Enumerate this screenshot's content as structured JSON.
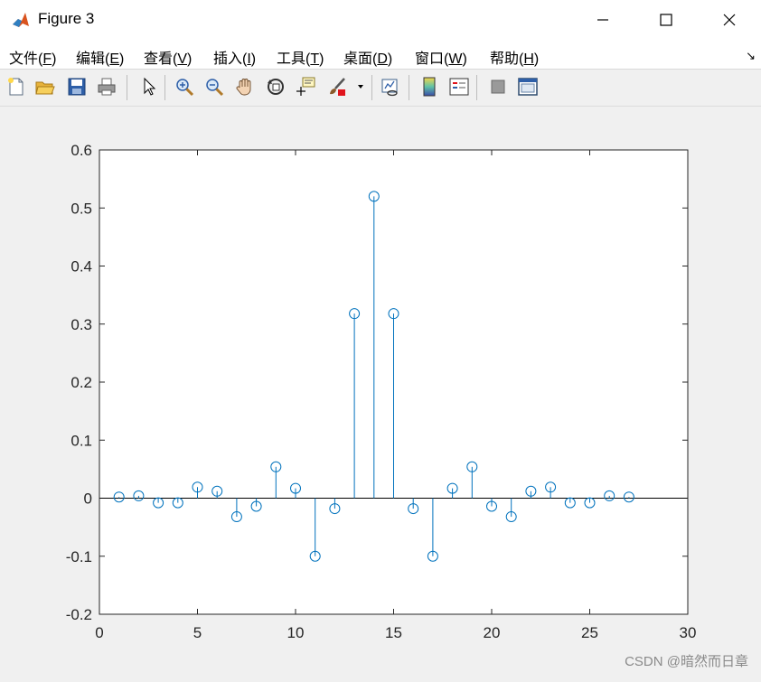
{
  "window": {
    "title": "Figure 3",
    "controls": {
      "minimize": "—",
      "maximize": "☐",
      "close": "✕"
    }
  },
  "menu": {
    "items": [
      {
        "label": "文件(",
        "key": "F",
        "suffix": ")"
      },
      {
        "label": "编辑(",
        "key": "E",
        "suffix": ")"
      },
      {
        "label": "查看(",
        "key": "V",
        "suffix": ")"
      },
      {
        "label": "插入(",
        "key": "I",
        "suffix": ")"
      },
      {
        "label": "工具(",
        "key": "T",
        "suffix": ")"
      },
      {
        "label": "桌面(",
        "key": "D",
        "suffix": ")"
      },
      {
        "label": "窗口(",
        "key": "W",
        "suffix": ")"
      },
      {
        "label": "帮助(",
        "key": "H",
        "suffix": ")"
      }
    ],
    "dock_arrow": "↘"
  },
  "toolbar": {
    "icons": [
      "new-figure-icon",
      "open-file-icon",
      "save-icon",
      "print-icon",
      "pointer-icon",
      "zoom-in-icon",
      "zoom-out-icon",
      "pan-hand-icon",
      "rotate-3d-icon",
      "data-cursor-icon",
      "brush-icon",
      "link-plot-icon",
      "colorbar-icon",
      "legend-icon",
      "hide-plot-tools-icon",
      "show-plot-tools-icon"
    ]
  },
  "chart_data": {
    "type": "stem",
    "title": "",
    "xlabel": "",
    "ylabel": "",
    "xlim": [
      0,
      30
    ],
    "ylim": [
      -0.2,
      0.6
    ],
    "xticks": [
      0,
      5,
      10,
      15,
      20,
      25,
      30
    ],
    "yticks": [
      -0.2,
      -0.1,
      0,
      0.1,
      0.2,
      0.3,
      0.4,
      0.5,
      0.6
    ],
    "ytick_labels": [
      "-0.2",
      "-0.1",
      "0",
      "0.1",
      "0.2",
      "0.3",
      "0.4",
      "0.5",
      "0.6"
    ],
    "xtick_labels": [
      "0",
      "5",
      "10",
      "15",
      "20",
      "25",
      "30"
    ],
    "grid": false,
    "series": [
      {
        "x": [
          1,
          2,
          3,
          4,
          5,
          6,
          7,
          8,
          9,
          10,
          11,
          12,
          13,
          14,
          15,
          16,
          17,
          18,
          19,
          20,
          21,
          22,
          23,
          24,
          25,
          26,
          27
        ],
        "values": [
          0.002,
          0.004,
          -0.008,
          -0.008,
          0.019,
          0.012,
          -0.032,
          -0.014,
          0.054,
          0.017,
          -0.1,
          -0.018,
          0.318,
          0.52,
          0.318,
          -0.018,
          -0.1,
          0.017,
          0.054,
          -0.014,
          -0.032,
          0.012,
          0.019,
          -0.008,
          -0.008,
          0.004,
          0.002
        ]
      }
    ],
    "color": "#0072bd",
    "baseline_color": "#000000"
  },
  "watermark": "CSDN @暗然而日章"
}
